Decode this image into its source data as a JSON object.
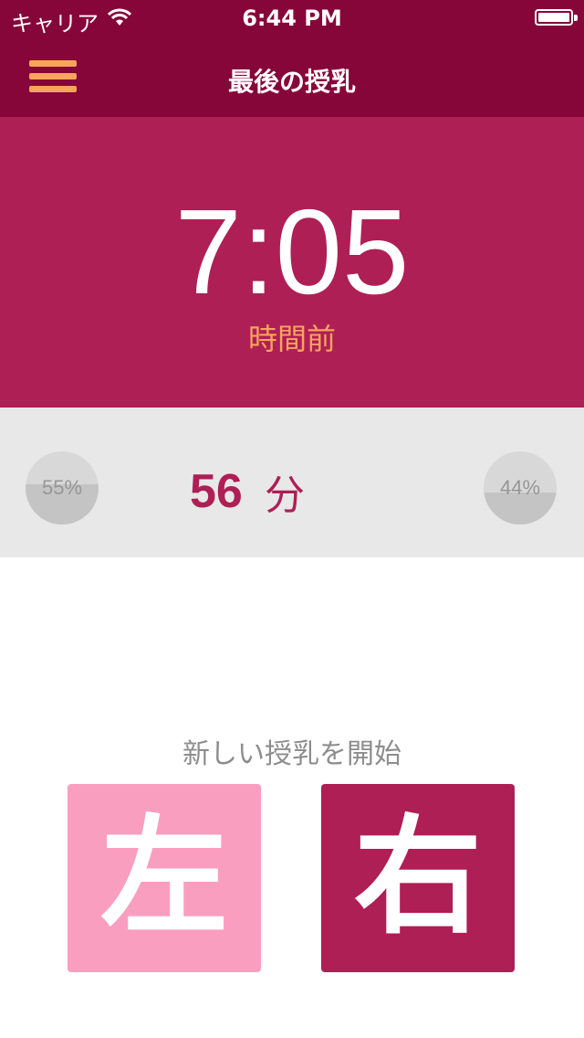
{
  "status_bar": {
    "carrier": "キャリア",
    "time": "6:44 PM",
    "wifi_icon": "wifi-icon",
    "battery_icon": "battery-icon",
    "battery_level": 1.0
  },
  "nav": {
    "menu_icon": "hamburger-menu-icon",
    "title": "最後の授乳"
  },
  "last_feed": {
    "elapsed": "7:05",
    "label": "時間前"
  },
  "stats": {
    "left_percent": "55%",
    "left_fraction": 0.55,
    "duration_value": "56",
    "duration_unit": "分",
    "right_percent": "44%",
    "right_fraction": 0.44
  },
  "start_feeding": {
    "prompt": "新しい授乳を開始",
    "left_label": "左",
    "right_label": "右"
  },
  "colors": {
    "bar": "#86063a",
    "accent": "#ae1f55",
    "highlight": "#f7a45c",
    "left_button": "#fa9ec0",
    "stats_bg": "#e8e8e8"
  }
}
